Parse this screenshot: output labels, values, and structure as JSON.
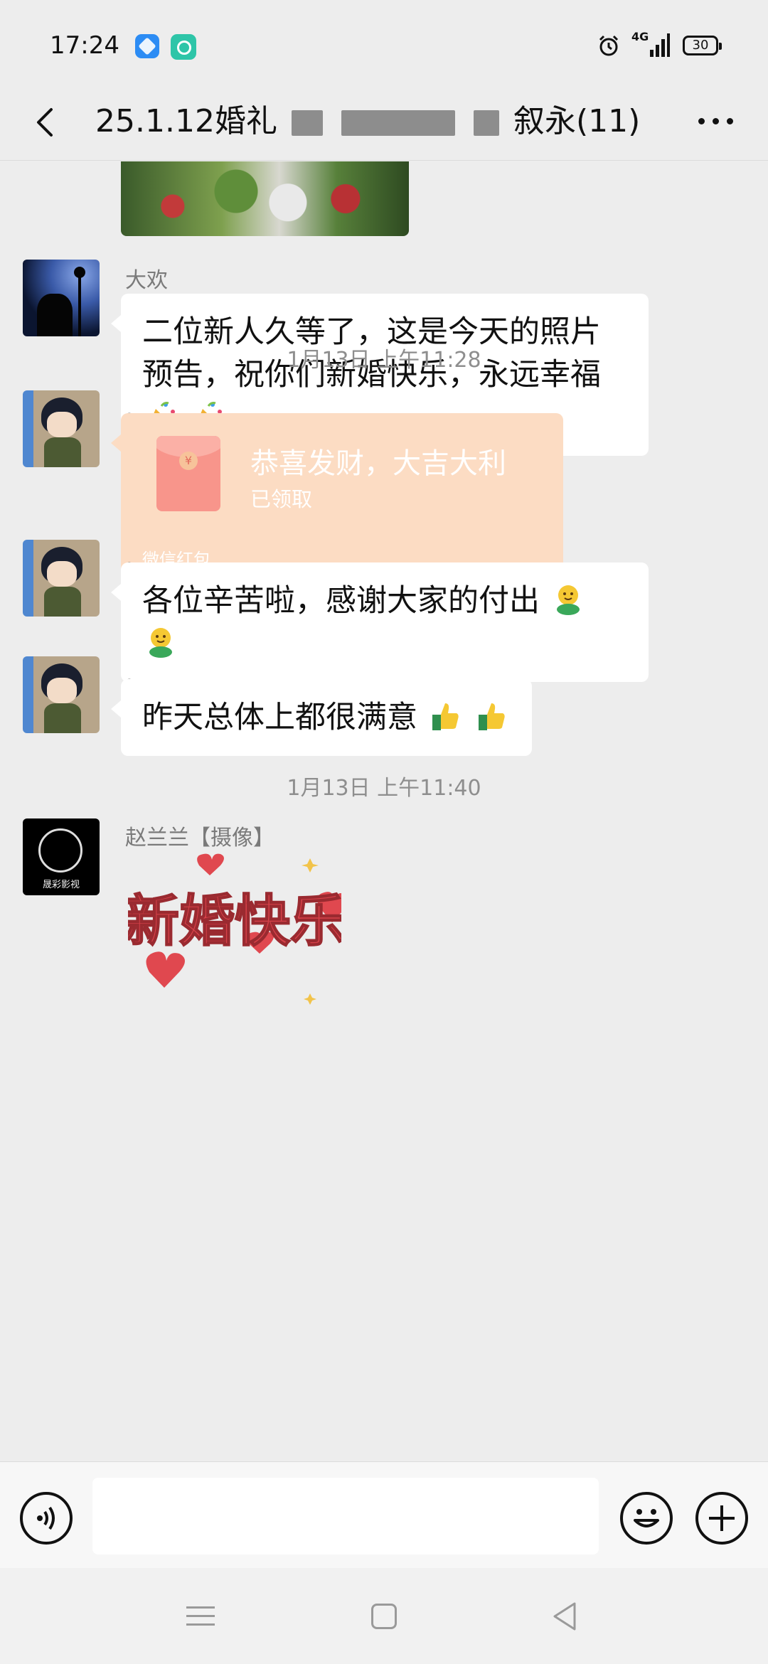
{
  "status_bar": {
    "time": "17:24",
    "network": "4G",
    "battery": "30"
  },
  "header": {
    "title_prefix": "25.1.12婚礼",
    "title_suffix": "叙永(11)"
  },
  "messages": [
    {
      "sender": "大欢",
      "text": "二位新人久等了，这是今天的照片预告，祝你们新婚快乐，永远幸福",
      "emojis": [
        "party-popper",
        "party-popper"
      ]
    },
    {
      "timestamp": "1月13日 上午11:28"
    },
    {
      "sender": "。",
      "red_packet": {
        "title": "恭喜发财，大吉大利",
        "status": "已领取",
        "footer": "微信红包"
      }
    },
    {
      "sender": "。",
      "text": "各位辛苦啦，感谢大家的付出",
      "emojis": [
        "hugging-face",
        "hugging-face"
      ]
    },
    {
      "sender": "。",
      "text": "昨天总体上都很满意",
      "emojis": [
        "thumbs-up",
        "thumbs-up"
      ]
    },
    {
      "timestamp": "1月13日 上午11:40"
    },
    {
      "sender": "赵兰兰【摄像】",
      "sticker_text": "新婚快乐",
      "avatar_text": "晟彩影视"
    }
  ],
  "input": {
    "value": "",
    "placeholder": ""
  },
  "colors": {
    "background": "#ededed",
    "bubble": "#ffffff",
    "red_packet": "#fcdcc3",
    "red_packet_icon": "#f8958b",
    "sticker_red": "#e0484f"
  }
}
